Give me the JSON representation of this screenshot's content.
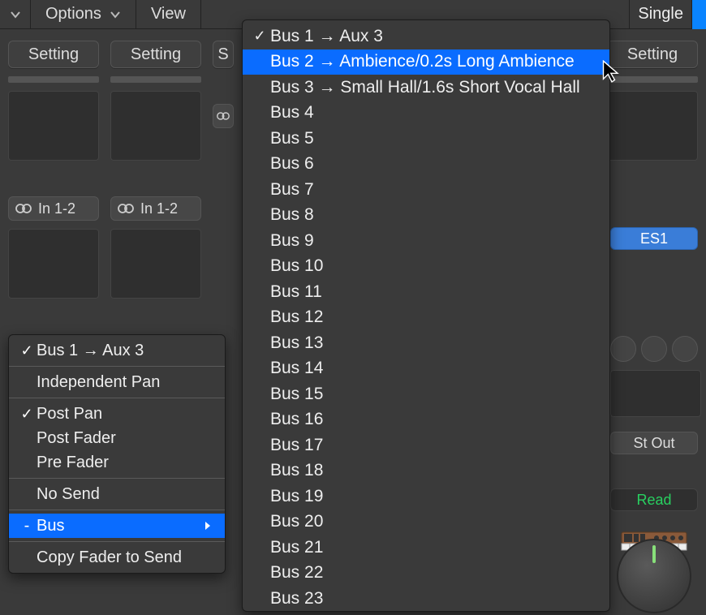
{
  "toolbar": {
    "options_label": "Options",
    "view_label": "View",
    "single_label": "Single"
  },
  "channels": {
    "setting_label": "Setting",
    "io_label": "In 1-2",
    "es1_label": "ES1",
    "stout_label": "St Out",
    "read_label": "Read"
  },
  "send_menu": {
    "items": [
      {
        "label": "Bus 1 → Aux 3",
        "checked": true,
        "type": "item"
      },
      {
        "type": "sep"
      },
      {
        "label": "Independent Pan",
        "checked": false,
        "type": "item"
      },
      {
        "type": "sep"
      },
      {
        "label": "Post Pan",
        "checked": true,
        "type": "item"
      },
      {
        "label": "Post Fader",
        "checked": false,
        "type": "item"
      },
      {
        "label": "Pre Fader",
        "checked": false,
        "type": "item"
      },
      {
        "type": "sep"
      },
      {
        "label": "No Send",
        "checked": false,
        "type": "item"
      },
      {
        "type": "sep"
      },
      {
        "label": "Bus",
        "checked": false,
        "type": "submenu",
        "highlighted": true,
        "dash": true
      },
      {
        "type": "sep"
      },
      {
        "label": "Copy Fader to Send",
        "checked": false,
        "type": "item"
      }
    ]
  },
  "bus_menu": {
    "items": [
      {
        "label": "Bus 1 → Aux 3",
        "checked": true
      },
      {
        "label": "Bus 2 → Ambience/0.2s Long Ambience",
        "checked": false,
        "highlighted": true
      },
      {
        "label": "Bus 3 → Small Hall/1.6s Short Vocal Hall",
        "checked": false
      },
      {
        "label": "Bus 4",
        "checked": false
      },
      {
        "label": "Bus 5",
        "checked": false
      },
      {
        "label": "Bus 6",
        "checked": false
      },
      {
        "label": "Bus 7",
        "checked": false
      },
      {
        "label": "Bus 8",
        "checked": false
      },
      {
        "label": "Bus 9",
        "checked": false
      },
      {
        "label": "Bus 10",
        "checked": false
      },
      {
        "label": "Bus 11",
        "checked": false
      },
      {
        "label": "Bus 12",
        "checked": false
      },
      {
        "label": "Bus 13",
        "checked": false
      },
      {
        "label": "Bus 14",
        "checked": false
      },
      {
        "label": "Bus 15",
        "checked": false
      },
      {
        "label": "Bus 16",
        "checked": false
      },
      {
        "label": "Bus 17",
        "checked": false
      },
      {
        "label": "Bus 18",
        "checked": false
      },
      {
        "label": "Bus 19",
        "checked": false
      },
      {
        "label": "Bus 20",
        "checked": false
      },
      {
        "label": "Bus 21",
        "checked": false
      },
      {
        "label": "Bus 22",
        "checked": false
      },
      {
        "label": "Bus 23",
        "checked": false
      }
    ]
  }
}
